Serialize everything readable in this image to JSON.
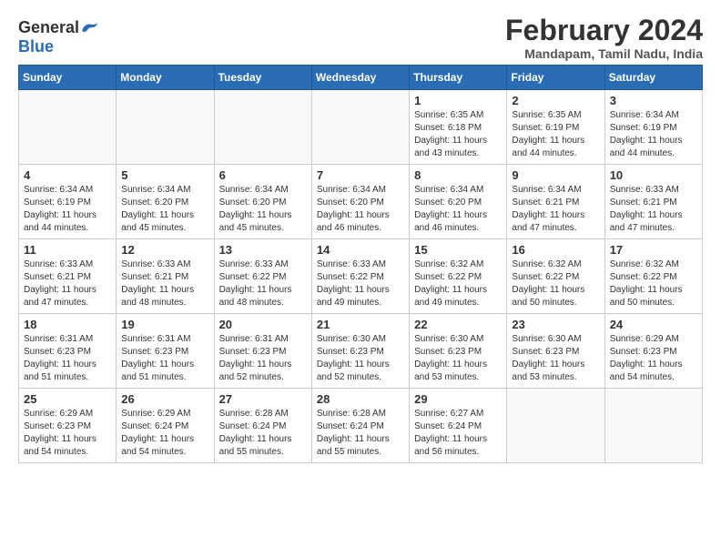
{
  "logo": {
    "general": "General",
    "blue": "Blue"
  },
  "title": "February 2024",
  "subtitle": "Mandapam, Tamil Nadu, India",
  "headers": [
    "Sunday",
    "Monday",
    "Tuesday",
    "Wednesday",
    "Thursday",
    "Friday",
    "Saturday"
  ],
  "weeks": [
    [
      {
        "day": "",
        "detail": ""
      },
      {
        "day": "",
        "detail": ""
      },
      {
        "day": "",
        "detail": ""
      },
      {
        "day": "",
        "detail": ""
      },
      {
        "day": "1",
        "detail": "Sunrise: 6:35 AM\nSunset: 6:18 PM\nDaylight: 11 hours\nand 43 minutes."
      },
      {
        "day": "2",
        "detail": "Sunrise: 6:35 AM\nSunset: 6:19 PM\nDaylight: 11 hours\nand 44 minutes."
      },
      {
        "day": "3",
        "detail": "Sunrise: 6:34 AM\nSunset: 6:19 PM\nDaylight: 11 hours\nand 44 minutes."
      }
    ],
    [
      {
        "day": "4",
        "detail": "Sunrise: 6:34 AM\nSunset: 6:19 PM\nDaylight: 11 hours\nand 44 minutes."
      },
      {
        "day": "5",
        "detail": "Sunrise: 6:34 AM\nSunset: 6:20 PM\nDaylight: 11 hours\nand 45 minutes."
      },
      {
        "day": "6",
        "detail": "Sunrise: 6:34 AM\nSunset: 6:20 PM\nDaylight: 11 hours\nand 45 minutes."
      },
      {
        "day": "7",
        "detail": "Sunrise: 6:34 AM\nSunset: 6:20 PM\nDaylight: 11 hours\nand 46 minutes."
      },
      {
        "day": "8",
        "detail": "Sunrise: 6:34 AM\nSunset: 6:20 PM\nDaylight: 11 hours\nand 46 minutes."
      },
      {
        "day": "9",
        "detail": "Sunrise: 6:34 AM\nSunset: 6:21 PM\nDaylight: 11 hours\nand 47 minutes."
      },
      {
        "day": "10",
        "detail": "Sunrise: 6:33 AM\nSunset: 6:21 PM\nDaylight: 11 hours\nand 47 minutes."
      }
    ],
    [
      {
        "day": "11",
        "detail": "Sunrise: 6:33 AM\nSunset: 6:21 PM\nDaylight: 11 hours\nand 47 minutes."
      },
      {
        "day": "12",
        "detail": "Sunrise: 6:33 AM\nSunset: 6:21 PM\nDaylight: 11 hours\nand 48 minutes."
      },
      {
        "day": "13",
        "detail": "Sunrise: 6:33 AM\nSunset: 6:22 PM\nDaylight: 11 hours\nand 48 minutes."
      },
      {
        "day": "14",
        "detail": "Sunrise: 6:33 AM\nSunset: 6:22 PM\nDaylight: 11 hours\nand 49 minutes."
      },
      {
        "day": "15",
        "detail": "Sunrise: 6:32 AM\nSunset: 6:22 PM\nDaylight: 11 hours\nand 49 minutes."
      },
      {
        "day": "16",
        "detail": "Sunrise: 6:32 AM\nSunset: 6:22 PM\nDaylight: 11 hours\nand 50 minutes."
      },
      {
        "day": "17",
        "detail": "Sunrise: 6:32 AM\nSunset: 6:22 PM\nDaylight: 11 hours\nand 50 minutes."
      }
    ],
    [
      {
        "day": "18",
        "detail": "Sunrise: 6:31 AM\nSunset: 6:23 PM\nDaylight: 11 hours\nand 51 minutes."
      },
      {
        "day": "19",
        "detail": "Sunrise: 6:31 AM\nSunset: 6:23 PM\nDaylight: 11 hours\nand 51 minutes."
      },
      {
        "day": "20",
        "detail": "Sunrise: 6:31 AM\nSunset: 6:23 PM\nDaylight: 11 hours\nand 52 minutes."
      },
      {
        "day": "21",
        "detail": "Sunrise: 6:30 AM\nSunset: 6:23 PM\nDaylight: 11 hours\nand 52 minutes."
      },
      {
        "day": "22",
        "detail": "Sunrise: 6:30 AM\nSunset: 6:23 PM\nDaylight: 11 hours\nand 53 minutes."
      },
      {
        "day": "23",
        "detail": "Sunrise: 6:30 AM\nSunset: 6:23 PM\nDaylight: 11 hours\nand 53 minutes."
      },
      {
        "day": "24",
        "detail": "Sunrise: 6:29 AM\nSunset: 6:23 PM\nDaylight: 11 hours\nand 54 minutes."
      }
    ],
    [
      {
        "day": "25",
        "detail": "Sunrise: 6:29 AM\nSunset: 6:23 PM\nDaylight: 11 hours\nand 54 minutes."
      },
      {
        "day": "26",
        "detail": "Sunrise: 6:29 AM\nSunset: 6:24 PM\nDaylight: 11 hours\nand 54 minutes."
      },
      {
        "day": "27",
        "detail": "Sunrise: 6:28 AM\nSunset: 6:24 PM\nDaylight: 11 hours\nand 55 minutes."
      },
      {
        "day": "28",
        "detail": "Sunrise: 6:28 AM\nSunset: 6:24 PM\nDaylight: 11 hours\nand 55 minutes."
      },
      {
        "day": "29",
        "detail": "Sunrise: 6:27 AM\nSunset: 6:24 PM\nDaylight: 11 hours\nand 56 minutes."
      },
      {
        "day": "",
        "detail": ""
      },
      {
        "day": "",
        "detail": ""
      }
    ]
  ]
}
